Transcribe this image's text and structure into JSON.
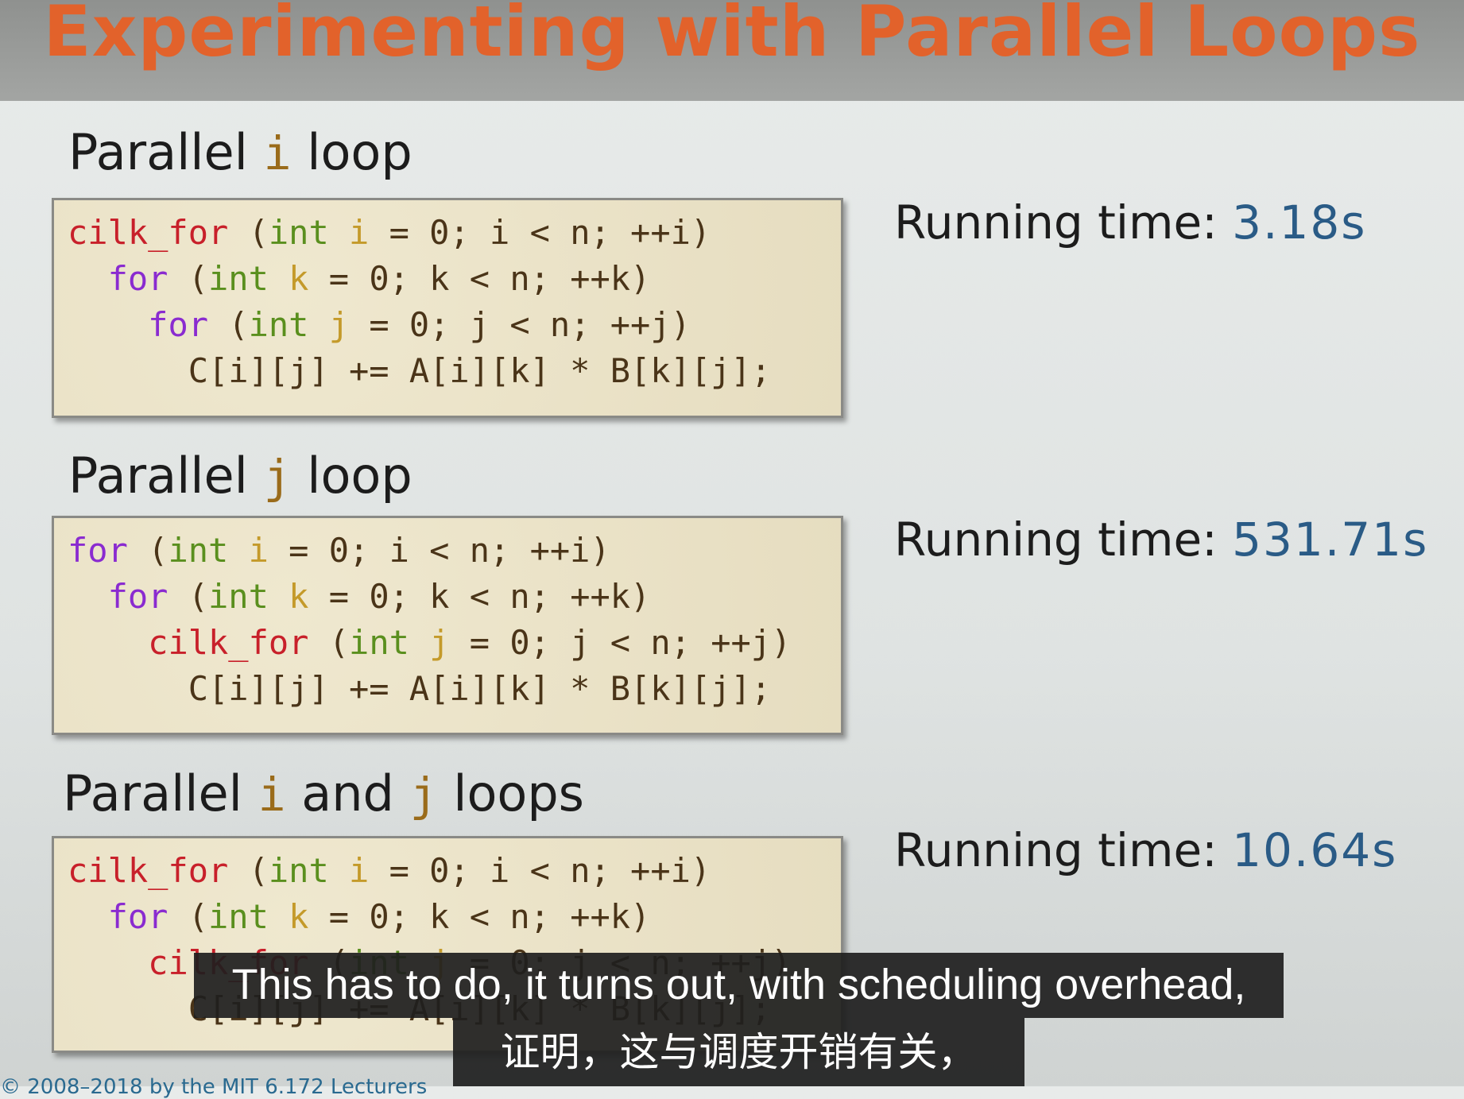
{
  "slide": {
    "title": "Experimenting with Parallel Loops",
    "footer": "© 2008–2018 by the MIT 6.172 Lecturers"
  },
  "sections": [
    {
      "heading": [
        "Parallel ",
        "i",
        " loop"
      ],
      "running_label": "Running time: ",
      "running_value": "3.18s",
      "code": [
        [
          [
            "cilk_for",
            "kw-cilk"
          ],
          [
            " (",
            "plain"
          ],
          [
            "int",
            "kw-int"
          ],
          [
            " ",
            "plain"
          ],
          [
            "i",
            "var"
          ],
          [
            " = 0; i < n; ++i)",
            "plain"
          ]
        ],
        [
          [
            "  ",
            "plain"
          ],
          [
            "for",
            "kw-for"
          ],
          [
            " (",
            "plain"
          ],
          [
            "int",
            "kw-int"
          ],
          [
            " ",
            "plain"
          ],
          [
            "k",
            "var"
          ],
          [
            " = 0; k < n; ++k)",
            "plain"
          ]
        ],
        [
          [
            "    ",
            "plain"
          ],
          [
            "for",
            "kw-for"
          ],
          [
            " (",
            "plain"
          ],
          [
            "int",
            "kw-int"
          ],
          [
            " ",
            "plain"
          ],
          [
            "j",
            "var"
          ],
          [
            " = 0; j < n; ++j)",
            "plain"
          ]
        ],
        [
          [
            "      C[i][j] += A[i][k] * B[k][j];",
            "plain"
          ]
        ]
      ]
    },
    {
      "heading": [
        "Parallel ",
        "j",
        " loop"
      ],
      "running_label": "Running time: ",
      "running_value": "531.71s",
      "code": [
        [
          [
            "for",
            "kw-for"
          ],
          [
            " (",
            "plain"
          ],
          [
            "int",
            "kw-int"
          ],
          [
            " ",
            "plain"
          ],
          [
            "i",
            "var"
          ],
          [
            " = 0; i < n; ++i)",
            "plain"
          ]
        ],
        [
          [
            "  ",
            "plain"
          ],
          [
            "for",
            "kw-for"
          ],
          [
            " (",
            "plain"
          ],
          [
            "int",
            "kw-int"
          ],
          [
            " ",
            "plain"
          ],
          [
            "k",
            "var"
          ],
          [
            " = 0; k < n; ++k)",
            "plain"
          ]
        ],
        [
          [
            "    ",
            "plain"
          ],
          [
            "cilk_for",
            "kw-cilk"
          ],
          [
            " (",
            "plain"
          ],
          [
            "int",
            "kw-int"
          ],
          [
            " ",
            "plain"
          ],
          [
            "j",
            "var"
          ],
          [
            " = 0; j < n; ++j)",
            "plain"
          ]
        ],
        [
          [
            "      C[i][j] += A[i][k] * B[k][j];",
            "plain"
          ]
        ]
      ]
    },
    {
      "heading": [
        "Parallel ",
        "i",
        " and ",
        "j",
        " loops"
      ],
      "running_label": "Running time: ",
      "running_value": "10.64s",
      "code": [
        [
          [
            "cilk_for",
            "kw-cilk"
          ],
          [
            " (",
            "plain"
          ],
          [
            "int",
            "kw-int"
          ],
          [
            " ",
            "plain"
          ],
          [
            "i",
            "var"
          ],
          [
            " = 0; i < n; ++i)",
            "plain"
          ]
        ],
        [
          [
            "  ",
            "plain"
          ],
          [
            "for",
            "kw-for"
          ],
          [
            " (",
            "plain"
          ],
          [
            "int",
            "kw-int"
          ],
          [
            " ",
            "plain"
          ],
          [
            "k",
            "var"
          ],
          [
            " = 0; k < n; ++k)",
            "plain"
          ]
        ],
        [
          [
            "    ",
            "plain"
          ],
          [
            "cilk_for",
            "kw-cilk"
          ],
          [
            " (",
            "plain"
          ],
          [
            "int",
            "kw-int"
          ],
          [
            " ",
            "plain"
          ],
          [
            "j",
            "var"
          ],
          [
            " = 0; j < n; ++j)",
            "plain"
          ]
        ],
        [
          [
            "      C[i][j] += A[i][k] * B[k][j];",
            "plain"
          ]
        ]
      ]
    }
  ],
  "subtitles": {
    "line1": "This has to do, it turns out, with scheduling overhead,",
    "line2": "证明，这与调度开销有关，"
  }
}
